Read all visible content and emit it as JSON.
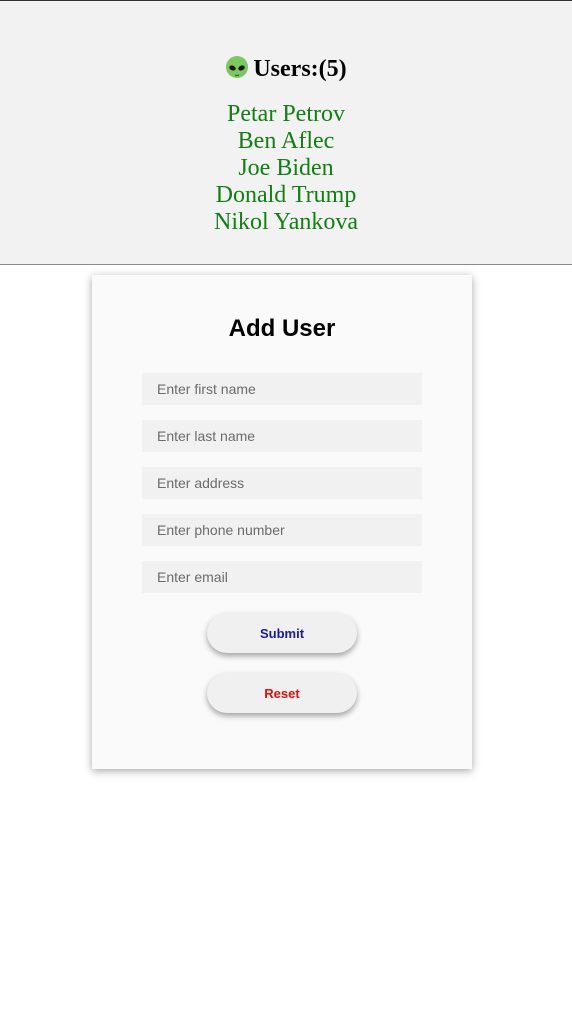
{
  "users_panel": {
    "heading": "Users:(5)",
    "icon": "alien-icon",
    "users": [
      "Petar Petrov",
      "Ben Aflec",
      "Joe Biden",
      "Donald Trump",
      "Nikol Yankova"
    ]
  },
  "form": {
    "title": "Add User",
    "fields": {
      "first_name": {
        "value": "",
        "placeholder": "Enter first name"
      },
      "last_name": {
        "value": "",
        "placeholder": "Enter last name"
      },
      "address": {
        "value": "",
        "placeholder": "Enter address"
      },
      "phone": {
        "value": "",
        "placeholder": "Enter phone number"
      },
      "email": {
        "value": "",
        "placeholder": "Enter email"
      }
    },
    "submit_label": "Submit",
    "reset_label": "Reset"
  },
  "colors": {
    "user_name": "#108010",
    "submit_text": "#1a1aa6",
    "reset_text": "#e01010",
    "panel_bg": "#f2f2f2"
  }
}
